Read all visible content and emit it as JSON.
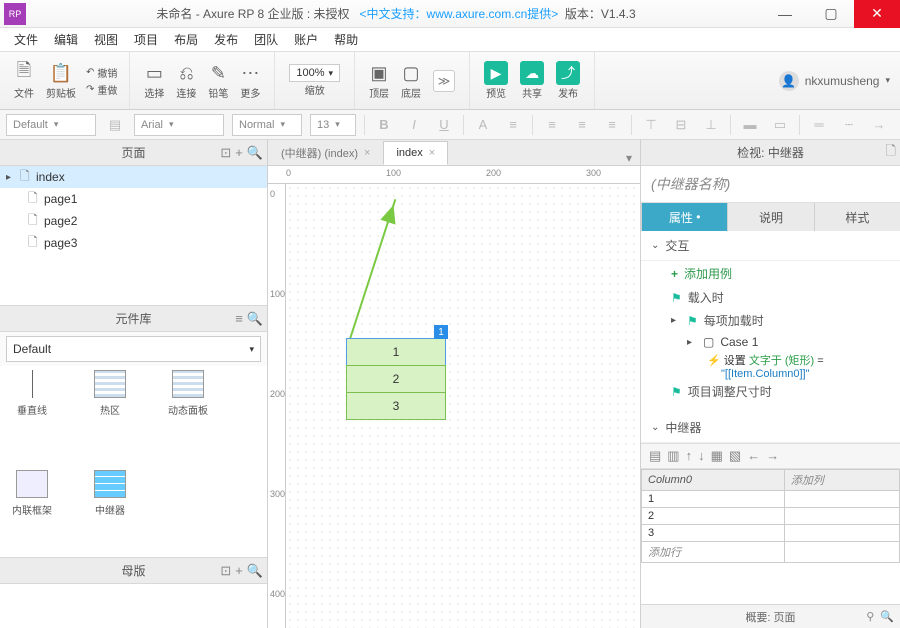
{
  "window": {
    "title_prefix": "未命名 - Axure RP 8 企业版 : 未授权",
    "title_link": "<中文支持：www.axure.com.cn提供>",
    "title_ver": "版本：V1.4.3",
    "min": "—",
    "max": "▢",
    "close": "✕",
    "logo": "RP"
  },
  "menu": [
    "文件",
    "编辑",
    "视图",
    "项目",
    "布局",
    "发布",
    "团队",
    "账户",
    "帮助"
  ],
  "toolbar": {
    "file": "文件",
    "clip": "剪贴板",
    "undo": "撤销",
    "redo": "重做",
    "select": "选择",
    "connect": "连接",
    "pen": "铅笔",
    "more": "更多",
    "zoom_label": "缩放",
    "zoom_value": "100%",
    "front": "顶层",
    "back": "底层",
    "preview": "预览",
    "share": "共享",
    "publish": "发布",
    "user": "nkxumusheng"
  },
  "fmt": {
    "style": "Default",
    "font": "Arial",
    "weight": "Normal",
    "size": "13"
  },
  "left": {
    "pages_title": "页面",
    "tree": [
      {
        "label": "index",
        "sel": true,
        "expand": true
      },
      {
        "label": "page1",
        "indent": 1
      },
      {
        "label": "page2",
        "indent": 1
      },
      {
        "label": "page3",
        "indent": 1
      }
    ],
    "lib_title": "元件库",
    "lib_name": "Default",
    "widgets": [
      {
        "label": "垂直线",
        "cls": "line"
      },
      {
        "label": "热区",
        "cls": "box"
      },
      {
        "label": "动态面板",
        "cls": "box"
      },
      {
        "label": "内联框架",
        "cls": "frame"
      },
      {
        "label": "中继器",
        "cls": "grid"
      }
    ],
    "masters_title": "母版"
  },
  "mid": {
    "tab_inactive": "(中继器) (index)",
    "tab_active": "index",
    "ruler_h": [
      "0",
      "100",
      "200",
      "300"
    ],
    "ruler_v": [
      "0",
      "100",
      "200",
      "300",
      "400"
    ],
    "repeater_rows": [
      "1",
      "2",
      "3"
    ],
    "sel_badge": "1"
  },
  "right": {
    "inspect_title": "检视: 中继器",
    "name_placeholder": "(中继器名称)",
    "tabs": {
      "props": "属性",
      "notes": "说明",
      "style": "样式"
    },
    "active_tab_marker": "•",
    "sec_ix": "交互",
    "add_case": "添加用例",
    "ev_load": "载入时",
    "ev_itemload": "每项加载时",
    "case1": "Case 1",
    "action_pre": "设置 ",
    "action_green": "文字于 (矩形)",
    "action_eq": " = ",
    "action_val": "\"[[Item.Column0]]\"",
    "ev_resize": "项目调整尺寸时",
    "sec_rep": "中继器",
    "col0": "Column0",
    "addcol": "添加列",
    "rows": [
      "1",
      "2",
      "3"
    ],
    "addrow": "添加行",
    "footer": "概要: 页面"
  }
}
